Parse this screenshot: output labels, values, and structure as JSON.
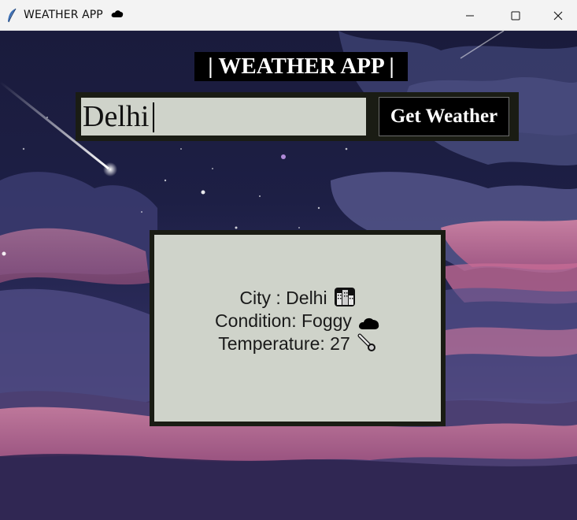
{
  "window": {
    "title": "WEATHER APP",
    "title_icon": "cloud-icon",
    "controls": [
      "minimize-icon",
      "maximize-icon",
      "close-icon"
    ]
  },
  "app": {
    "heading": "| WEATHER APP |",
    "search": {
      "value": "Delhi",
      "placeholder": ""
    },
    "button_label": "Get Weather"
  },
  "result": {
    "city_line": "City : Delhi",
    "city_icon": "cityscape-icon",
    "condition_line": "Condition: Foggy",
    "condition_icon": "cloud-icon",
    "temperature_line": "Temperature: 27",
    "temperature_icon": "thermometer-icon"
  },
  "colors": {
    "panel": "#cfd3ca",
    "frame": "#1a1c14",
    "button": "#000000",
    "sky": "#1b1d3a"
  }
}
